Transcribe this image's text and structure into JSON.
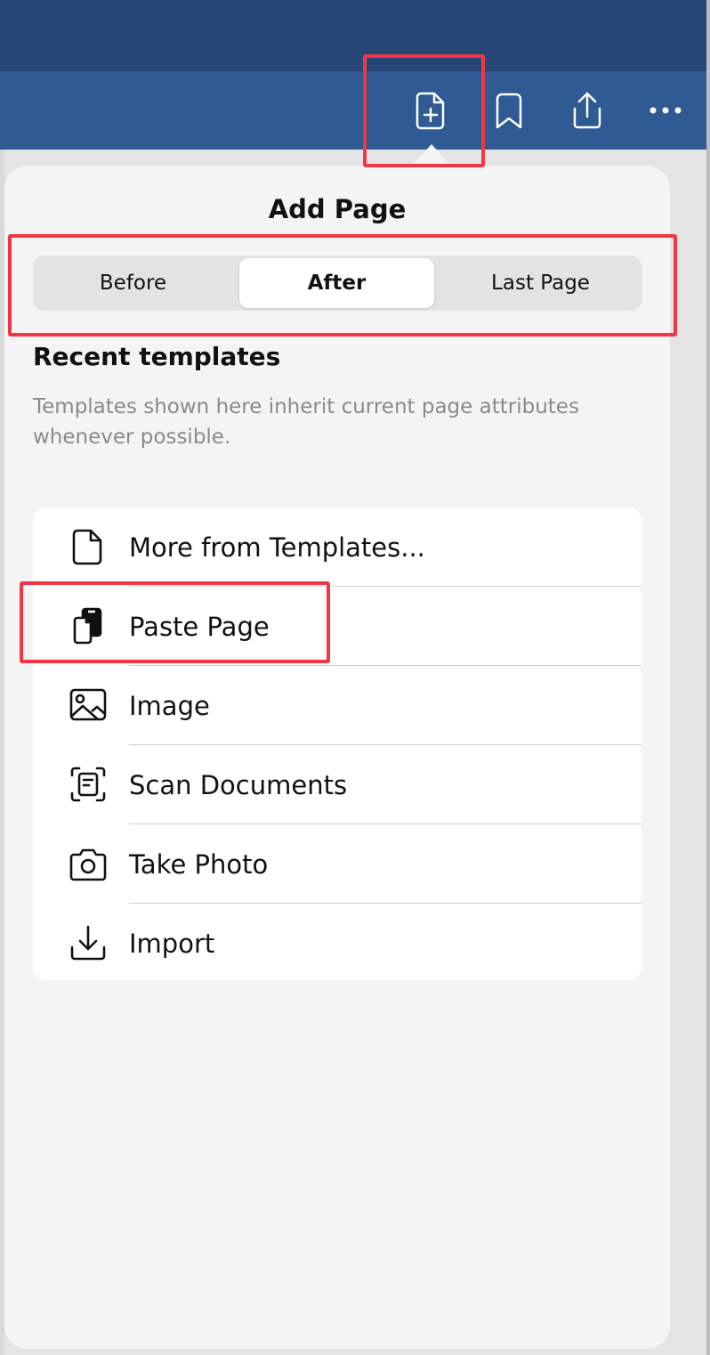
{
  "toolbar": {
    "icons": [
      "add-page-icon",
      "bookmark-icon",
      "share-icon",
      "more-icon"
    ]
  },
  "popover": {
    "title": "Add Page",
    "position_options": [
      "Before",
      "After",
      "Last Page"
    ],
    "selected_position": "After",
    "section_title": "Recent templates",
    "section_description": "Templates shown here inherit current page attributes whenever possible.",
    "items": [
      {
        "label": "More from Templates...",
        "icon": "document-icon"
      },
      {
        "label": "Paste Page",
        "icon": "paste-page-icon"
      },
      {
        "label": "Image",
        "icon": "image-icon"
      },
      {
        "label": "Scan Documents",
        "icon": "scan-icon"
      },
      {
        "label": "Take Photo",
        "icon": "camera-icon"
      },
      {
        "label": "Import",
        "icon": "import-icon"
      }
    ]
  },
  "colors": {
    "topbar": "#284675",
    "toolbar": "#2f5a94",
    "annotation": "#f23645"
  }
}
